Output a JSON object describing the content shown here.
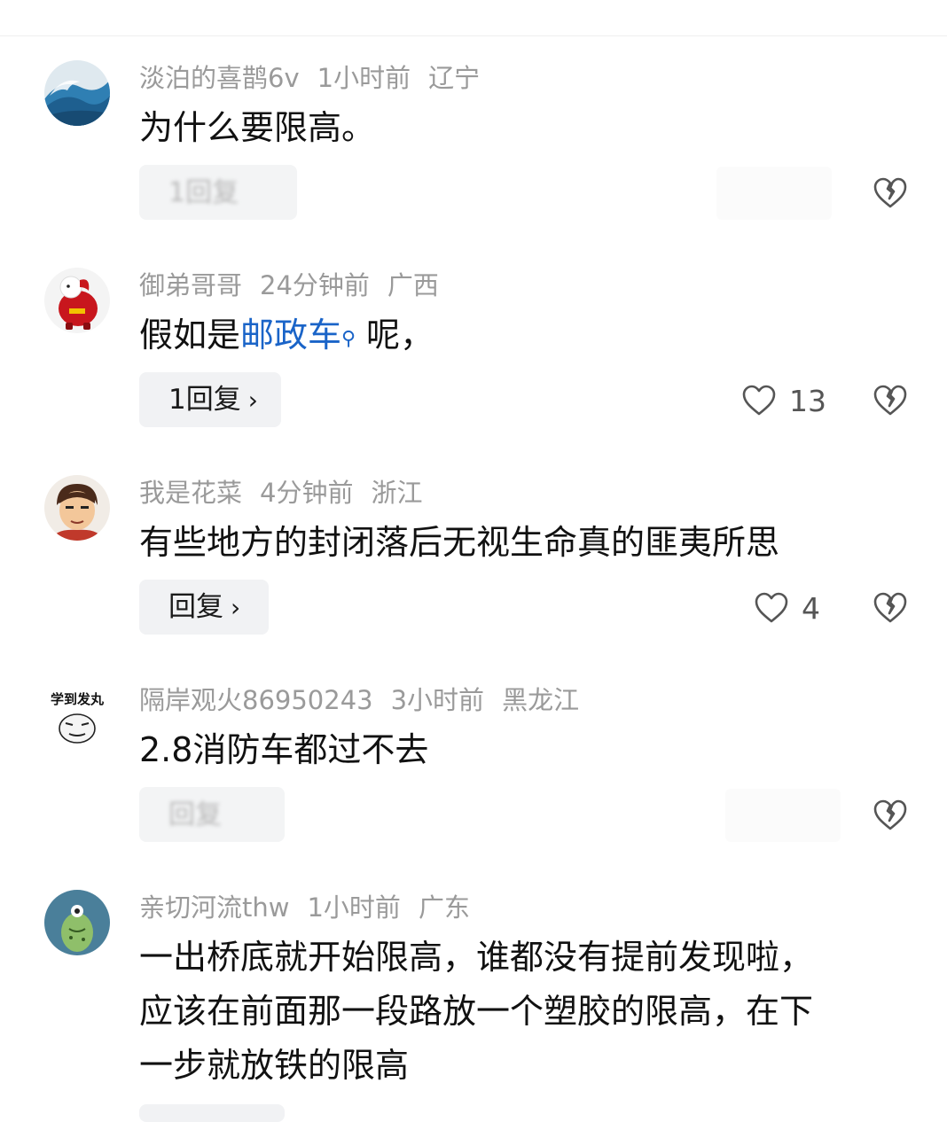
{
  "comments": [
    {
      "username": "淡泊的喜鹊6v",
      "time": "1小时前",
      "region": "辽宁",
      "text": "为什么要限高。",
      "reply_label": "1回复",
      "reply_blurred": true,
      "likes": ""
    },
    {
      "username": "御弟哥哥",
      "time": "24分钟前",
      "region": "广西",
      "text_before": "假如是",
      "link_text": "邮政车",
      "text_after": "呢，",
      "reply_label": "1回复",
      "reply_blurred": false,
      "likes": "13"
    },
    {
      "username": "我是花菜",
      "time": "4分钟前",
      "region": "浙江",
      "text": "有些地方的封闭落后无视生命真的匪夷所思",
      "reply_label": "回复",
      "reply_blurred": false,
      "likes": "4"
    },
    {
      "username": "隔岸观火86950243",
      "time": "3小时前",
      "region": "黑龙江",
      "avatar_caption": "学到发丸",
      "text": "2.8消防车都过不去",
      "reply_label": "回复",
      "reply_blurred": true,
      "likes": ""
    },
    {
      "username": "亲切河流thw",
      "time": "1小时前",
      "region": "广东",
      "text_lines": [
        "一出桥底就开始限高，谁都没有提前发现啦，",
        "应该在前面那一段路放一个塑胶的限高，在下",
        "一步就放铁的限高"
      ]
    }
  ],
  "icons": {
    "heart": "heart-outline-icon",
    "dislike": "broken-heart-icon",
    "search": "search-icon",
    "chevron": "chevron-right-icon"
  },
  "colors": {
    "link": "#1a64c8",
    "meta": "#9a9a9a",
    "reply_bg": "#f1f2f4"
  },
  "glyphs": {
    "chevron": "›",
    "search": "⚲"
  }
}
